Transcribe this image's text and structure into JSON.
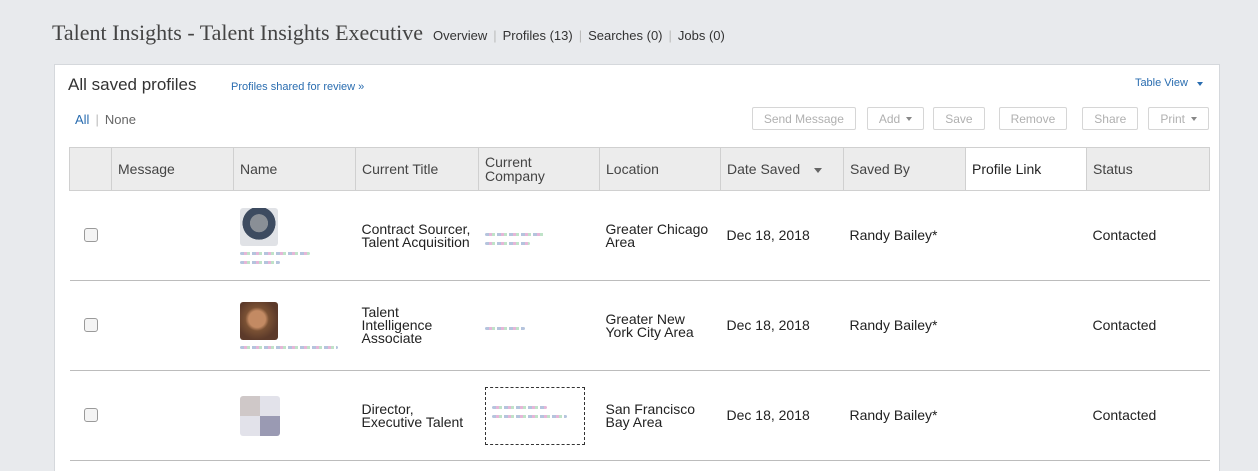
{
  "header": {
    "title": "Talent Insights - Talent Insights Executive",
    "nav": [
      "Overview",
      "Profiles (13)",
      "Searches (0)",
      "Jobs (0)"
    ]
  },
  "panel": {
    "title": "All saved profiles",
    "shared_link": "Profiles shared for review »",
    "view_label": "Table View",
    "select_all": "All",
    "select_none": "None"
  },
  "toolbar": {
    "send_message": "Send Message",
    "add": "Add",
    "save": "Save",
    "remove": "Remove",
    "share": "Share",
    "print": "Print"
  },
  "columns": {
    "message": "Message",
    "name": "Name",
    "current_title": "Current Title",
    "current_company": "Current Company",
    "location": "Location",
    "date_saved": "Date Saved",
    "saved_by": "Saved By",
    "profile_link": "Profile Link",
    "status": "Status"
  },
  "rows": [
    {
      "title": "Contract Sourcer, Talent Acquisition",
      "location": "Greater Chicago Area",
      "date_saved": "Dec 18, 2018",
      "saved_by": "Randy Bailey*",
      "status": "Contacted"
    },
    {
      "title": "Talent Intelligence Associate",
      "location": "Greater New York City Area",
      "date_saved": "Dec 18, 2018",
      "saved_by": "Randy Bailey*",
      "status": "Contacted"
    },
    {
      "title": "Director, Executive Talent",
      "location": "San Francisco Bay Area",
      "date_saved": "Dec 18, 2018",
      "saved_by": "Randy Bailey*",
      "status": "Contacted"
    }
  ],
  "colors": {
    "link": "#2a6db0",
    "background": "#e8eaed",
    "header_fill": "#ececec"
  }
}
